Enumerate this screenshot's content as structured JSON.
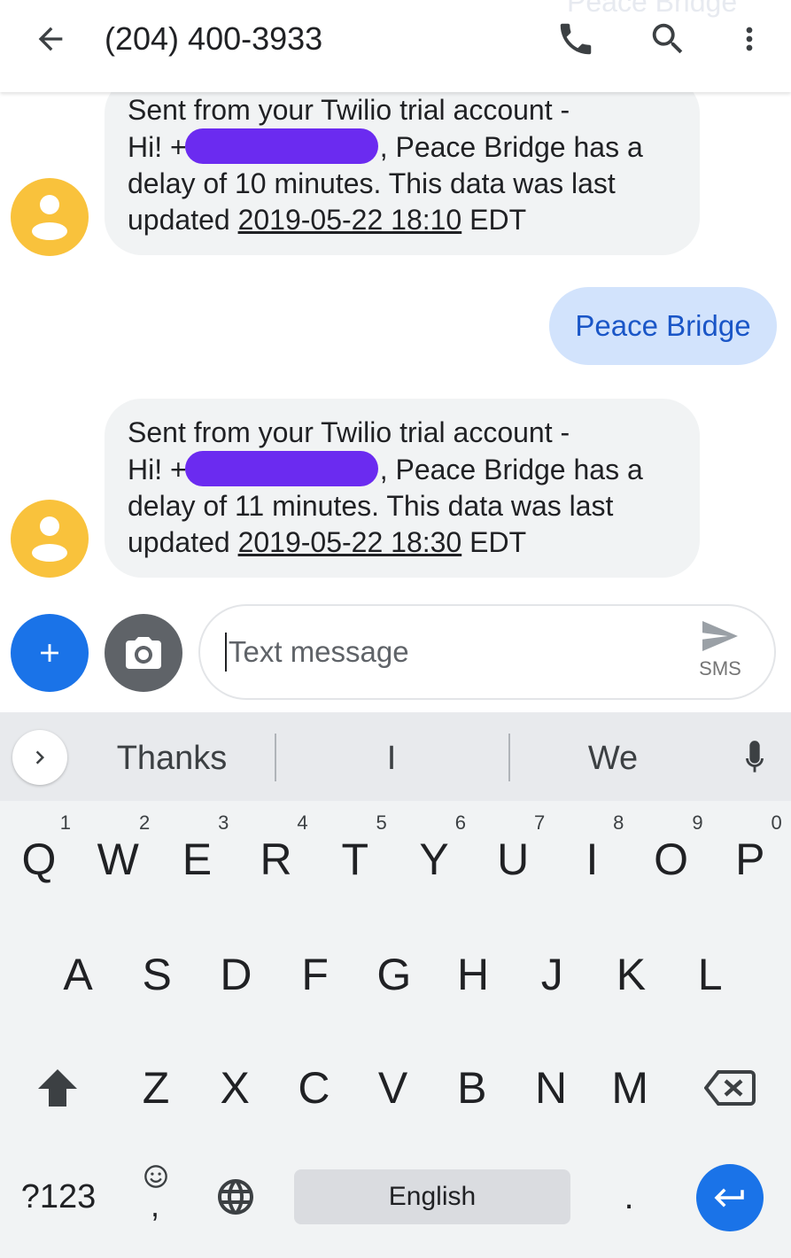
{
  "header": {
    "title": "(204) 400-3933",
    "ghost_title": "Peace Bridge",
    "icons": [
      "back-arrow-icon",
      "phone-icon",
      "search-icon",
      "more-vert-icon"
    ]
  },
  "messages": [
    {
      "direction": "incoming",
      "line1": "Sent from your Twilio trial account -",
      "line2_prefix": "Hi! +",
      "line2_suffix": ", Peace Bridge has a",
      "line3": "delay of 10 minutes. This data was last",
      "line4_prefix": "updated ",
      "timestamp": "2019-05-22 18:10",
      "line4_suffix": " EDT"
    },
    {
      "direction": "outgoing",
      "text": "Peace Bridge"
    },
    {
      "direction": "incoming",
      "line1": "Sent from your Twilio trial account -",
      "line2_prefix": "Hi! +",
      "line2_suffix": ", Peace Bridge has a",
      "line3": "delay of 11 minutes. This data was last",
      "line4_prefix": "updated ",
      "timestamp": "2019-05-22 18:30",
      "line4_suffix": " EDT"
    }
  ],
  "compose": {
    "placeholder": "Text message",
    "send_label": "SMS"
  },
  "keyboard": {
    "suggestions": [
      "Thanks",
      "I",
      "We"
    ],
    "row1": [
      {
        "key": "Q",
        "hint": "1"
      },
      {
        "key": "W",
        "hint": "2"
      },
      {
        "key": "E",
        "hint": "3"
      },
      {
        "key": "R",
        "hint": "4"
      },
      {
        "key": "T",
        "hint": "5"
      },
      {
        "key": "Y",
        "hint": "6"
      },
      {
        "key": "U",
        "hint": "7"
      },
      {
        "key": "I",
        "hint": "8"
      },
      {
        "key": "O",
        "hint": "9"
      },
      {
        "key": "P",
        "hint": "0"
      }
    ],
    "row2": [
      "A",
      "S",
      "D",
      "F",
      "G",
      "H",
      "J",
      "K",
      "L"
    ],
    "row3": [
      "Z",
      "X",
      "C",
      "V",
      "B",
      "N",
      "M"
    ],
    "symbols_label": "?123",
    "comma_label": ",",
    "space_label": "English",
    "period_label": ".",
    "colors": {
      "accent": "#1a73e8",
      "avatar": "#f9c23c",
      "incoming_bubble": "#f1f3f4",
      "outgoing_bubble": "#d2e3fc",
      "redaction": "#6b2bf0"
    }
  }
}
